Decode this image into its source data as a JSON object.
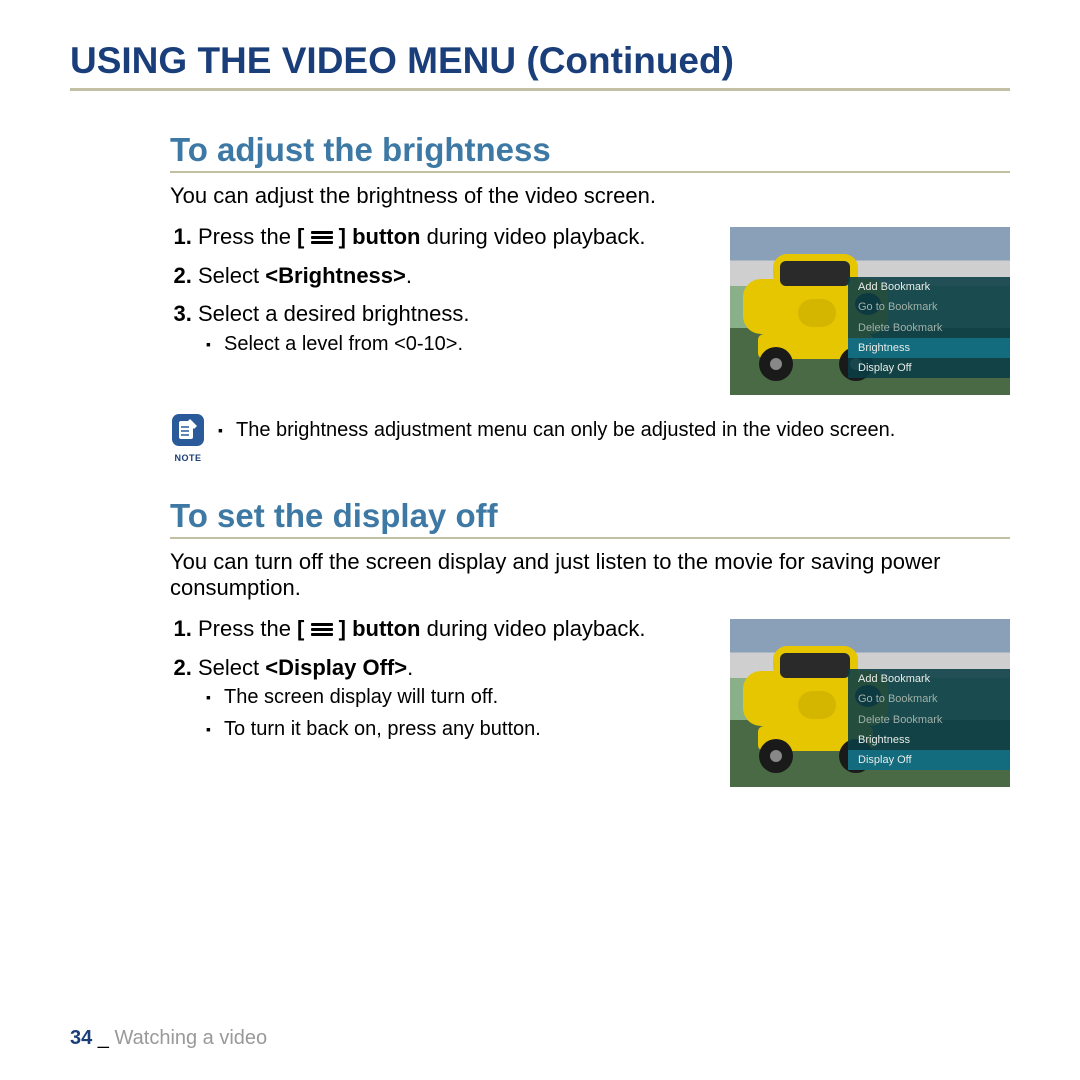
{
  "page_title": "USING THE VIDEO MENU (Continued)",
  "section1": {
    "title": "To adjust the brightness",
    "intro": "You can adjust the brightness of the video screen.",
    "step1_a": "Press the ",
    "step1_b": "[",
    "step1_c": "] button",
    "step1_d": " during video playback.",
    "step2_a": "Select ",
    "step2_b": "<Brightness>",
    "step2_c": ".",
    "step3": "Select a desired brightness.",
    "step3_sub": "Select a level from <0-10>.",
    "note_label": "NOTE",
    "note_text": "The brightness adjustment menu can only be adjusted in the video screen.",
    "menu": {
      "items": [
        "Add Bookmark",
        "Go to Bookmark",
        "Delete Bookmark",
        "Brightness",
        "Display Off"
      ],
      "selected": 3
    }
  },
  "section2": {
    "title": "To set the display off",
    "intro": "You can turn off the screen display and just listen to the movie for saving power consumption.",
    "step1_a": "Press the ",
    "step1_b": "[",
    "step1_c": "] button",
    "step1_d": " during video playback.",
    "step2_a": "Select ",
    "step2_b": "<Display Off>",
    "step2_c": ".",
    "sub1": "The screen display will turn off.",
    "sub2": "To turn it back on, press any button.",
    "menu": {
      "items": [
        "Add Bookmark",
        "Go to Bookmark",
        "Delete Bookmark",
        "Brightness",
        "Display Off"
      ],
      "selected": 4
    }
  },
  "footer": {
    "page": "34",
    "sep": " _ ",
    "chapter": "Watching a video"
  }
}
